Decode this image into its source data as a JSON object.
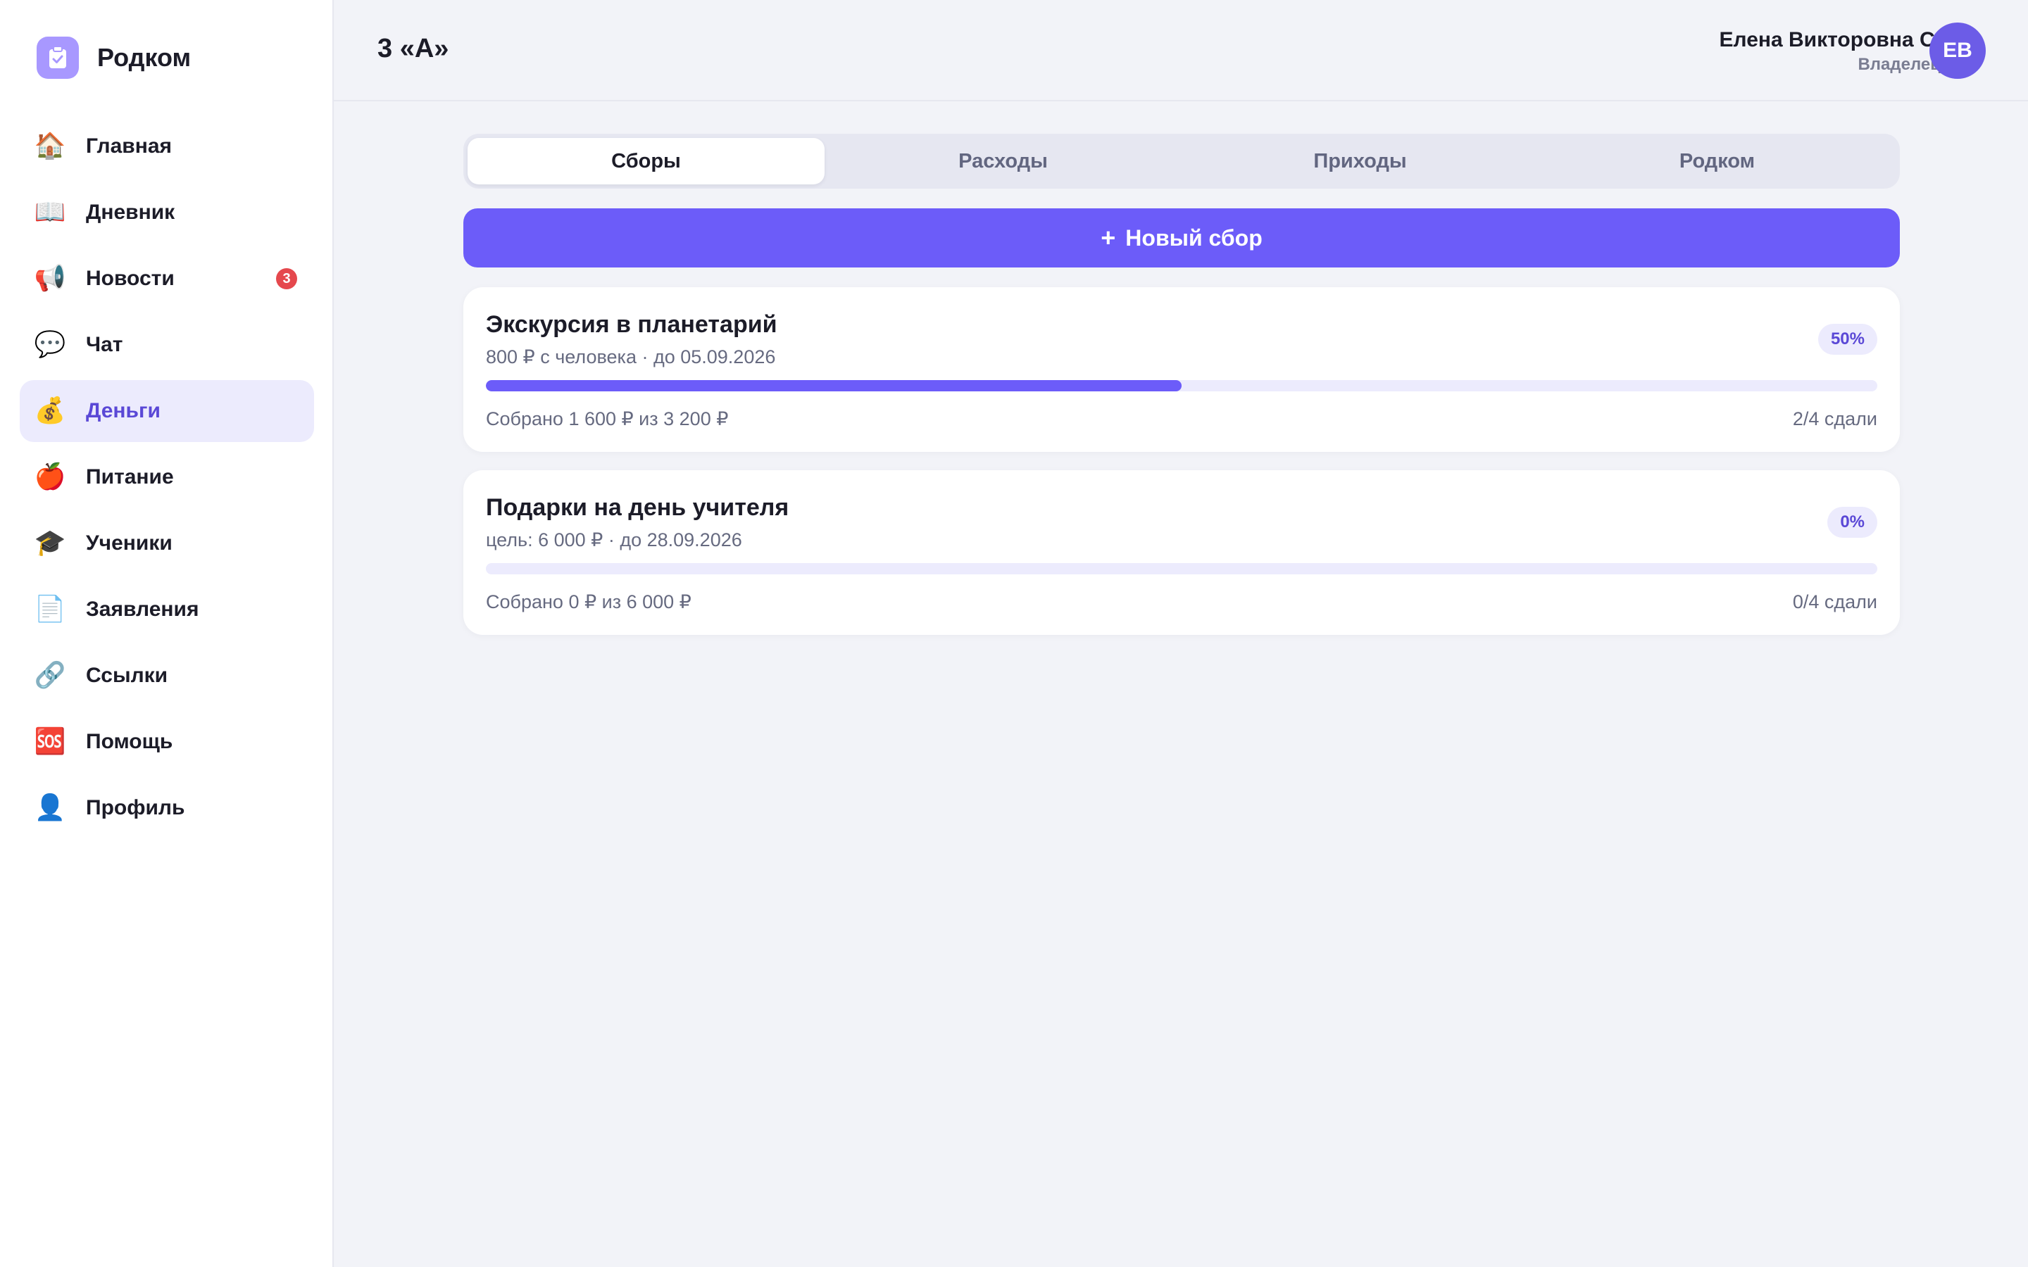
{
  "brand": {
    "name": "Родком",
    "icon": "clipboard-check-icon",
    "color": "#a898ff"
  },
  "sidebar": {
    "items": [
      {
        "label": "Главная",
        "icon": "🏠",
        "icon_name": "home-icon",
        "active": false
      },
      {
        "label": "Дневник",
        "icon": "📖",
        "icon_name": "book-icon",
        "active": false
      },
      {
        "label": "Новости",
        "icon": "📢",
        "icon_name": "megaphone-icon",
        "active": false,
        "badge": "3"
      },
      {
        "label": "Чат",
        "icon": "💬",
        "icon_name": "chat-bubble-icon",
        "active": false
      },
      {
        "label": "Деньги",
        "icon": "💰",
        "icon_name": "money-bag-icon",
        "active": true
      },
      {
        "label": "Питание",
        "icon": "🍎",
        "icon_name": "apple-icon",
        "active": false
      },
      {
        "label": "Ученики",
        "icon": "🎓",
        "icon_name": "graduation-cap-icon",
        "active": false
      },
      {
        "label": "Заявления",
        "icon": "📄",
        "icon_name": "document-icon",
        "active": false
      },
      {
        "label": "Ссылки",
        "icon": "🔗",
        "icon_name": "link-icon",
        "active": false
      },
      {
        "label": "Помощь",
        "icon": "🆘",
        "icon_name": "sos-icon",
        "active": false
      },
      {
        "label": "Профиль",
        "icon": "👤",
        "icon_name": "user-icon",
        "active": false
      }
    ]
  },
  "header": {
    "class_title": "3 «А»",
    "user_name": "Елена Викторовна С.",
    "user_role": "Владелец",
    "avatar_initials": "ЕВ"
  },
  "tabs": [
    {
      "label": "Сборы",
      "active": true
    },
    {
      "label": "Расходы",
      "active": false
    },
    {
      "label": "Приходы",
      "active": false
    },
    {
      "label": "Родком",
      "active": false
    }
  ],
  "new_button": {
    "plus": "+",
    "label": "Новый сбор"
  },
  "collections": [
    {
      "title": "Экскурсия в планетарий",
      "subtitle": "800 ₽ с человека · до 05.09.2026",
      "percent_label": "50%",
      "progress": 0.5,
      "collected": "Собрано 1 600 ₽ из 3 200 ₽",
      "paid": "2/4 сдали"
    },
    {
      "title": "Подарки на день учителя",
      "subtitle": "цель: 6 000 ₽ · до 28.09.2026",
      "percent_label": "0%",
      "progress": 0,
      "collected": "Собрано 0 ₽ из 6 000 ₽",
      "paid": "0/4 сдали"
    }
  ],
  "colors": {
    "accent": "#6c5cf9",
    "accent_text": "#5a48d6",
    "accent_soft": "#ecebfd",
    "badge": "#e5484d",
    "background": "#f2f3f8"
  }
}
